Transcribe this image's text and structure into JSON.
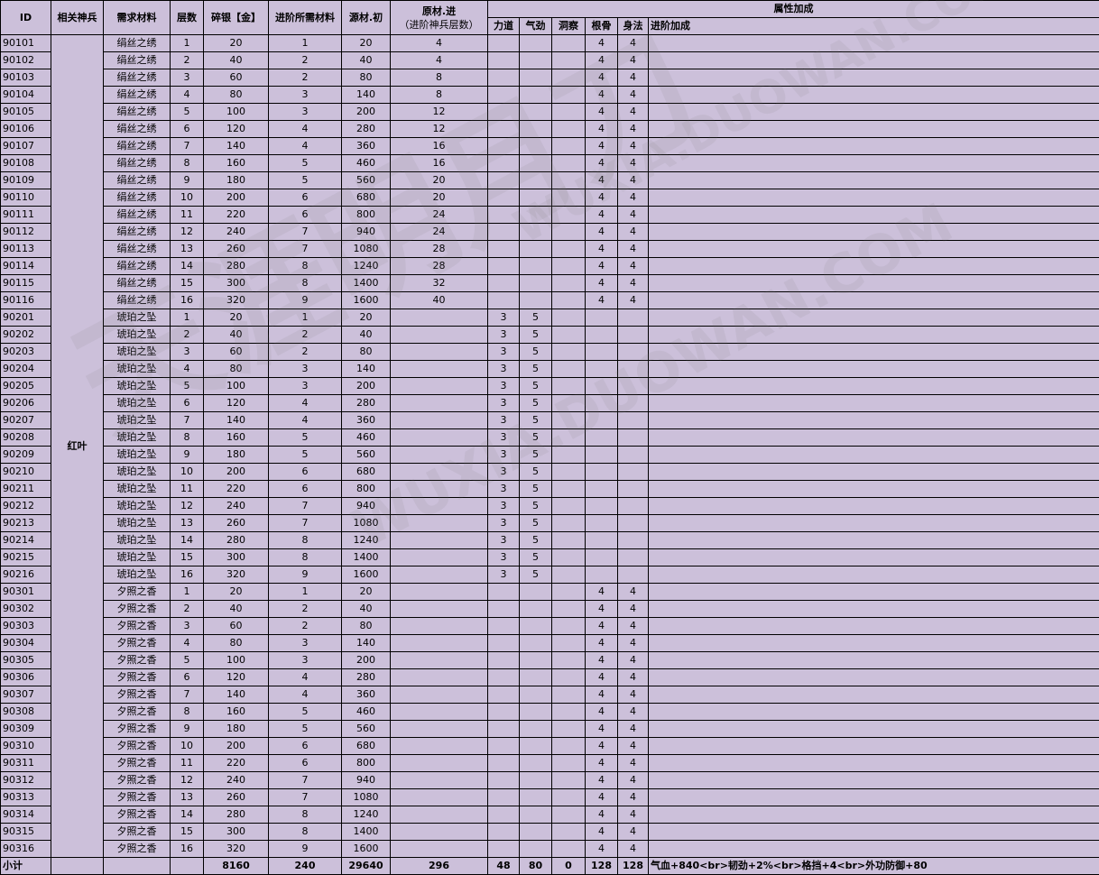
{
  "headers": {
    "id": "ID",
    "weapon": "相关神兵",
    "material": "需求材料",
    "layer": "层数",
    "silver": "碎银【金】",
    "adv_material": "进阶所需材料",
    "source_init": "源材.初",
    "raw_adv_line1": "原材.进",
    "raw_adv_line2": "（进阶神兵层数）",
    "attr_group": "属性加成",
    "strength": "力道",
    "qi": "气劲",
    "insight": "洞察",
    "root": "根骨",
    "agility": "身法",
    "adv_bonus": "进阶加成"
  },
  "weapon_name": "红叶",
  "rows": [
    {
      "id": "90101",
      "mat": "绢丝之绣",
      "layer": "1",
      "silver": "20",
      "adv": "1",
      "src": "20",
      "raw": "4",
      "str": "",
      "qi": "",
      "ins": "",
      "root": "4",
      "agi": "4"
    },
    {
      "id": "90102",
      "mat": "绢丝之绣",
      "layer": "2",
      "silver": "40",
      "adv": "2",
      "src": "40",
      "raw": "4",
      "str": "",
      "qi": "",
      "ins": "",
      "root": "4",
      "agi": "4"
    },
    {
      "id": "90103",
      "mat": "绢丝之绣",
      "layer": "3",
      "silver": "60",
      "adv": "2",
      "src": "80",
      "raw": "8",
      "str": "",
      "qi": "",
      "ins": "",
      "root": "4",
      "agi": "4"
    },
    {
      "id": "90104",
      "mat": "绢丝之绣",
      "layer": "4",
      "silver": "80",
      "adv": "3",
      "src": "140",
      "raw": "8",
      "str": "",
      "qi": "",
      "ins": "",
      "root": "4",
      "agi": "4"
    },
    {
      "id": "90105",
      "mat": "绢丝之绣",
      "layer": "5",
      "silver": "100",
      "adv": "3",
      "src": "200",
      "raw": "12",
      "str": "",
      "qi": "",
      "ins": "",
      "root": "4",
      "agi": "4"
    },
    {
      "id": "90106",
      "mat": "绢丝之绣",
      "layer": "6",
      "silver": "120",
      "adv": "4",
      "src": "280",
      "raw": "12",
      "str": "",
      "qi": "",
      "ins": "",
      "root": "4",
      "agi": "4"
    },
    {
      "id": "90107",
      "mat": "绢丝之绣",
      "layer": "7",
      "silver": "140",
      "adv": "4",
      "src": "360",
      "raw": "16",
      "str": "",
      "qi": "",
      "ins": "",
      "root": "4",
      "agi": "4"
    },
    {
      "id": "90108",
      "mat": "绢丝之绣",
      "layer": "8",
      "silver": "160",
      "adv": "5",
      "src": "460",
      "raw": "16",
      "str": "",
      "qi": "",
      "ins": "",
      "root": "4",
      "agi": "4"
    },
    {
      "id": "90109",
      "mat": "绢丝之绣",
      "layer": "9",
      "silver": "180",
      "adv": "5",
      "src": "560",
      "raw": "20",
      "str": "",
      "qi": "",
      "ins": "",
      "root": "4",
      "agi": "4"
    },
    {
      "id": "90110",
      "mat": "绢丝之绣",
      "layer": "10",
      "silver": "200",
      "adv": "6",
      "src": "680",
      "raw": "20",
      "str": "",
      "qi": "",
      "ins": "",
      "root": "4",
      "agi": "4"
    },
    {
      "id": "90111",
      "mat": "绢丝之绣",
      "layer": "11",
      "silver": "220",
      "adv": "6",
      "src": "800",
      "raw": "24",
      "str": "",
      "qi": "",
      "ins": "",
      "root": "4",
      "agi": "4"
    },
    {
      "id": "90112",
      "mat": "绢丝之绣",
      "layer": "12",
      "silver": "240",
      "adv": "7",
      "src": "940",
      "raw": "24",
      "str": "",
      "qi": "",
      "ins": "",
      "root": "4",
      "agi": "4"
    },
    {
      "id": "90113",
      "mat": "绢丝之绣",
      "layer": "13",
      "silver": "260",
      "adv": "7",
      "src": "1080",
      "raw": "28",
      "str": "",
      "qi": "",
      "ins": "",
      "root": "4",
      "agi": "4"
    },
    {
      "id": "90114",
      "mat": "绢丝之绣",
      "layer": "14",
      "silver": "280",
      "adv": "8",
      "src": "1240",
      "raw": "28",
      "str": "",
      "qi": "",
      "ins": "",
      "root": "4",
      "agi": "4"
    },
    {
      "id": "90115",
      "mat": "绢丝之绣",
      "layer": "15",
      "silver": "300",
      "adv": "8",
      "src": "1400",
      "raw": "32",
      "str": "",
      "qi": "",
      "ins": "",
      "root": "4",
      "agi": "4"
    },
    {
      "id": "90116",
      "mat": "绢丝之绣",
      "layer": "16",
      "silver": "320",
      "adv": "9",
      "src": "1600",
      "raw": "40",
      "str": "",
      "qi": "",
      "ins": "",
      "root": "4",
      "agi": "4"
    },
    {
      "id": "90201",
      "mat": "琥珀之坠",
      "layer": "1",
      "silver": "20",
      "adv": "1",
      "src": "20",
      "raw": "",
      "str": "3",
      "qi": "5",
      "ins": "",
      "root": "",
      "agi": ""
    },
    {
      "id": "90202",
      "mat": "琥珀之坠",
      "layer": "2",
      "silver": "40",
      "adv": "2",
      "src": "40",
      "raw": "",
      "str": "3",
      "qi": "5",
      "ins": "",
      "root": "",
      "agi": ""
    },
    {
      "id": "90203",
      "mat": "琥珀之坠",
      "layer": "3",
      "silver": "60",
      "adv": "2",
      "src": "80",
      "raw": "",
      "str": "3",
      "qi": "5",
      "ins": "",
      "root": "",
      "agi": ""
    },
    {
      "id": "90204",
      "mat": "琥珀之坠",
      "layer": "4",
      "silver": "80",
      "adv": "3",
      "src": "140",
      "raw": "",
      "str": "3",
      "qi": "5",
      "ins": "",
      "root": "",
      "agi": ""
    },
    {
      "id": "90205",
      "mat": "琥珀之坠",
      "layer": "5",
      "silver": "100",
      "adv": "3",
      "src": "200",
      "raw": "",
      "str": "3",
      "qi": "5",
      "ins": "",
      "root": "",
      "agi": ""
    },
    {
      "id": "90206",
      "mat": "琥珀之坠",
      "layer": "6",
      "silver": "120",
      "adv": "4",
      "src": "280",
      "raw": "",
      "str": "3",
      "qi": "5",
      "ins": "",
      "root": "",
      "agi": ""
    },
    {
      "id": "90207",
      "mat": "琥珀之坠",
      "layer": "7",
      "silver": "140",
      "adv": "4",
      "src": "360",
      "raw": "",
      "str": "3",
      "qi": "5",
      "ins": "",
      "root": "",
      "agi": ""
    },
    {
      "id": "90208",
      "mat": "琥珀之坠",
      "layer": "8",
      "silver": "160",
      "adv": "5",
      "src": "460",
      "raw": "",
      "str": "3",
      "qi": "5",
      "ins": "",
      "root": "",
      "agi": ""
    },
    {
      "id": "90209",
      "mat": "琥珀之坠",
      "layer": "9",
      "silver": "180",
      "adv": "5",
      "src": "560",
      "raw": "",
      "str": "3",
      "qi": "5",
      "ins": "",
      "root": "",
      "agi": ""
    },
    {
      "id": "90210",
      "mat": "琥珀之坠",
      "layer": "10",
      "silver": "200",
      "adv": "6",
      "src": "680",
      "raw": "",
      "str": "3",
      "qi": "5",
      "ins": "",
      "root": "",
      "agi": ""
    },
    {
      "id": "90211",
      "mat": "琥珀之坠",
      "layer": "11",
      "silver": "220",
      "adv": "6",
      "src": "800",
      "raw": "",
      "str": "3",
      "qi": "5",
      "ins": "",
      "root": "",
      "agi": ""
    },
    {
      "id": "90212",
      "mat": "琥珀之坠",
      "layer": "12",
      "silver": "240",
      "adv": "7",
      "src": "940",
      "raw": "",
      "str": "3",
      "qi": "5",
      "ins": "",
      "root": "",
      "agi": ""
    },
    {
      "id": "90213",
      "mat": "琥珀之坠",
      "layer": "13",
      "silver": "260",
      "adv": "7",
      "src": "1080",
      "raw": "",
      "str": "3",
      "qi": "5",
      "ins": "",
      "root": "",
      "agi": ""
    },
    {
      "id": "90214",
      "mat": "琥珀之坠",
      "layer": "14",
      "silver": "280",
      "adv": "8",
      "src": "1240",
      "raw": "",
      "str": "3",
      "qi": "5",
      "ins": "",
      "root": "",
      "agi": ""
    },
    {
      "id": "90215",
      "mat": "琥珀之坠",
      "layer": "15",
      "silver": "300",
      "adv": "8",
      "src": "1400",
      "raw": "",
      "str": "3",
      "qi": "5",
      "ins": "",
      "root": "",
      "agi": ""
    },
    {
      "id": "90216",
      "mat": "琥珀之坠",
      "layer": "16",
      "silver": "320",
      "adv": "9",
      "src": "1600",
      "raw": "",
      "str": "3",
      "qi": "5",
      "ins": "",
      "root": "",
      "agi": ""
    },
    {
      "id": "90301",
      "mat": "夕照之香",
      "layer": "1",
      "silver": "20",
      "adv": "1",
      "src": "20",
      "raw": "",
      "str": "",
      "qi": "",
      "ins": "",
      "root": "4",
      "agi": "4"
    },
    {
      "id": "90302",
      "mat": "夕照之香",
      "layer": "2",
      "silver": "40",
      "adv": "2",
      "src": "40",
      "raw": "",
      "str": "",
      "qi": "",
      "ins": "",
      "root": "4",
      "agi": "4"
    },
    {
      "id": "90303",
      "mat": "夕照之香",
      "layer": "3",
      "silver": "60",
      "adv": "2",
      "src": "80",
      "raw": "",
      "str": "",
      "qi": "",
      "ins": "",
      "root": "4",
      "agi": "4"
    },
    {
      "id": "90304",
      "mat": "夕照之香",
      "layer": "4",
      "silver": "80",
      "adv": "3",
      "src": "140",
      "raw": "",
      "str": "",
      "qi": "",
      "ins": "",
      "root": "4",
      "agi": "4"
    },
    {
      "id": "90305",
      "mat": "夕照之香",
      "layer": "5",
      "silver": "100",
      "adv": "3",
      "src": "200",
      "raw": "",
      "str": "",
      "qi": "",
      "ins": "",
      "root": "4",
      "agi": "4"
    },
    {
      "id": "90306",
      "mat": "夕照之香",
      "layer": "6",
      "silver": "120",
      "adv": "4",
      "src": "280",
      "raw": "",
      "str": "",
      "qi": "",
      "ins": "",
      "root": "4",
      "agi": "4"
    },
    {
      "id": "90307",
      "mat": "夕照之香",
      "layer": "7",
      "silver": "140",
      "adv": "4",
      "src": "360",
      "raw": "",
      "str": "",
      "qi": "",
      "ins": "",
      "root": "4",
      "agi": "4"
    },
    {
      "id": "90308",
      "mat": "夕照之香",
      "layer": "8",
      "silver": "160",
      "adv": "5",
      "src": "460",
      "raw": "",
      "str": "",
      "qi": "",
      "ins": "",
      "root": "4",
      "agi": "4"
    },
    {
      "id": "90309",
      "mat": "夕照之香",
      "layer": "9",
      "silver": "180",
      "adv": "5",
      "src": "560",
      "raw": "",
      "str": "",
      "qi": "",
      "ins": "",
      "root": "4",
      "agi": "4"
    },
    {
      "id": "90310",
      "mat": "夕照之香",
      "layer": "10",
      "silver": "200",
      "adv": "6",
      "src": "680",
      "raw": "",
      "str": "",
      "qi": "",
      "ins": "",
      "root": "4",
      "agi": "4"
    },
    {
      "id": "90311",
      "mat": "夕照之香",
      "layer": "11",
      "silver": "220",
      "adv": "6",
      "src": "800",
      "raw": "",
      "str": "",
      "qi": "",
      "ins": "",
      "root": "4",
      "agi": "4"
    },
    {
      "id": "90312",
      "mat": "夕照之香",
      "layer": "12",
      "silver": "240",
      "adv": "7",
      "src": "940",
      "raw": "",
      "str": "",
      "qi": "",
      "ins": "",
      "root": "4",
      "agi": "4"
    },
    {
      "id": "90313",
      "mat": "夕照之香",
      "layer": "13",
      "silver": "260",
      "adv": "7",
      "src": "1080",
      "raw": "",
      "str": "",
      "qi": "",
      "ins": "",
      "root": "4",
      "agi": "4"
    },
    {
      "id": "90314",
      "mat": "夕照之香",
      "layer": "14",
      "silver": "280",
      "adv": "8",
      "src": "1240",
      "raw": "",
      "str": "",
      "qi": "",
      "ins": "",
      "root": "4",
      "agi": "4"
    },
    {
      "id": "90315",
      "mat": "夕照之香",
      "layer": "15",
      "silver": "300",
      "adv": "8",
      "src": "1400",
      "raw": "",
      "str": "",
      "qi": "",
      "ins": "",
      "root": "4",
      "agi": "4"
    },
    {
      "id": "90316",
      "mat": "夕照之香",
      "layer": "16",
      "silver": "320",
      "adv": "9",
      "src": "1600",
      "raw": "",
      "str": "",
      "qi": "",
      "ins": "",
      "root": "4",
      "agi": "4"
    }
  ],
  "total": {
    "label": "小计",
    "silver": "8160",
    "adv": "240",
    "src": "29640",
    "raw": "296",
    "str": "48",
    "qi": "80",
    "ins": "0",
    "root": "128",
    "agi": "128",
    "bonus": "气血+840<br>韧劲+2%<br>格挡+4<br>外功防御+80"
  },
  "watermark": {
    "text_a": "WUXIA.DUOWAN.COM",
    "text_b": "天涯明月刀"
  },
  "colors": {
    "cell_bg": "#ccc0da",
    "border": "#000000"
  }
}
